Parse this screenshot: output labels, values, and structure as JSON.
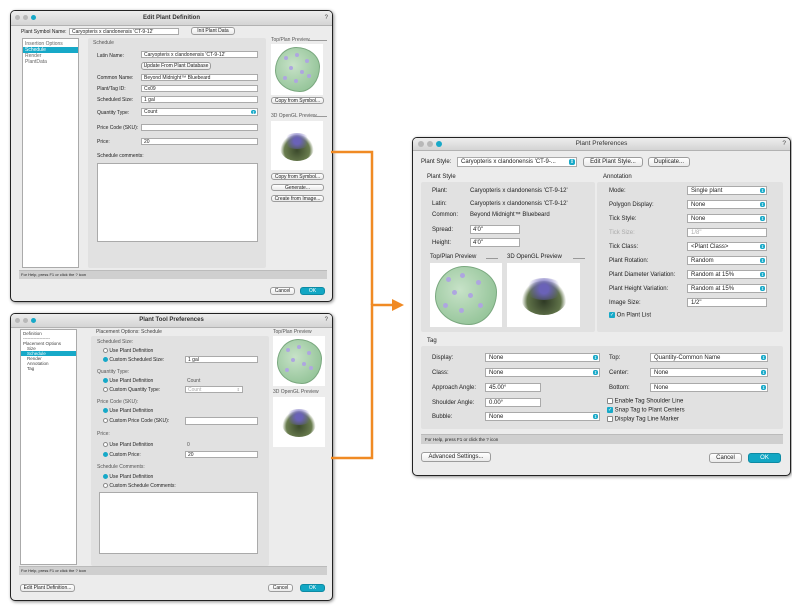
{
  "colors": {
    "accent": "#17a9c8",
    "arrow": "#f08a24",
    "close": "#e0443c",
    "min": "#e8b23a",
    "max": "#5cc04a"
  },
  "edit_plant": {
    "title": "Edit Plant Definition",
    "help": "?",
    "symbol_label": "Plant Symbol Name:",
    "symbol_value": "Caryopteris x clandonensis 'CT-9-12'",
    "init_button": "Init Plant Data",
    "sidebar": [
      "Insertion Options",
      "Schedule",
      "Render",
      "PlantData"
    ],
    "section": "Schedule",
    "latin_label": "Latin Name:",
    "latin_value": "Caryopteris x clandonensis 'CT-9-12'",
    "update_button": "Update From Plant Database",
    "common_label": "Common Name:",
    "common_value": "Beyond Midnight™ Bluebeard",
    "tag_label": "Plant/Tag ID:",
    "tag_value": "Cx09",
    "sched_size_label": "Scheduled Size:",
    "sched_size_value": "1 gal",
    "qty_label": "Quantity Type:",
    "qty_value": "Count",
    "price_code_label": "Price Code (SKU):",
    "price_code_value": "",
    "price_label": "Price:",
    "price_value": "20",
    "comments_label": "Schedule comments:",
    "top_preview": "Top/Plan Preview",
    "copy_symbol": "Copy from Symbol...",
    "opengl_preview": "3D OpenGL Preview",
    "copy_symbol2": "Copy from Symbol...",
    "generate": "Generate...",
    "create_image": "Create from Image...",
    "status": "For Help, press F1 or click the ? icon",
    "cancel": "Cancel",
    "ok": "OK"
  },
  "tool_prefs": {
    "title": "Plant Tool Preferences",
    "help": "?",
    "sidebar": [
      "Definition",
      "------------------",
      "Placement Options",
      "Size",
      "Schedule",
      "Render",
      "Annotation",
      "Tag"
    ],
    "section": "Placement Options: Schedule",
    "sched_size": "Scheduled Size:",
    "use_def": "Use Plant Definition",
    "custom_size": "Custom Scheduled Size:",
    "custom_size_value": "1 gal",
    "qty_type": "Quantity Type:",
    "use_def2": "Use Plant Definition",
    "count": "Count",
    "custom_qty": "Custom Quantity Type:",
    "custom_qty_value": "Count",
    "price_code": "Price Code (SKU):",
    "use_def3": "Use Plant Definition",
    "custom_price_code": "Custom Price Code (SKU):",
    "price": "Price:",
    "use_def4": "Use Plant Definition",
    "zero": "0",
    "custom_price": "Custom Price:",
    "custom_price_value": "20",
    "sched_comments": "Schedule Comments:",
    "use_def5": "Use Plant Definition",
    "custom_comments": "Custom Schedule Comments:",
    "top_preview": "Top/Plan Preview",
    "opengl_preview": "3D OpenGL Preview",
    "status": "For Help, press F1 or click the ? icon",
    "edit_button": "Edit Plant Definition...",
    "cancel": "Cancel",
    "ok": "OK"
  },
  "plant_prefs": {
    "title": "Plant Preferences",
    "help": "?",
    "style_label": "Plant Style:",
    "style_value": "Caryopteris x clandonensis 'CT-9-...",
    "edit_style": "Edit Plant Style...",
    "duplicate": "Duplicate...",
    "plant_style": "Plant Style",
    "plant_label": "Plant:",
    "plant_value": "Caryopteris x clandonensis 'CT-9-12'",
    "latin_label": "Latin:",
    "latin_value": "Caryopteris x clandonensis 'CT-9-12'",
    "common_label": "Common:",
    "common_value": "Beyond Midnight™ Bluebeard",
    "spread_label": "Spread:",
    "spread_value": "4'0\"",
    "height_label": "Height:",
    "height_value": "4'0\"",
    "top_preview": "Top/Plan Preview",
    "opengl_preview": "3D OpenGL Preview",
    "annotation": "Annotation",
    "mode_label": "Mode:",
    "mode_value": "Single plant",
    "polygon_label": "Polygon Display:",
    "polygon_value": "None",
    "tick_style_label": "Tick Style:",
    "tick_style_value": "None",
    "tick_size_label": "Tick Size:",
    "tick_size_value": "1/8\"",
    "tick_class_label": "Tick Class:",
    "tick_class_value": "<Plant Class>",
    "rotation_label": "Plant Rotation:",
    "rotation_value": "Random",
    "diam_label": "Plant Diameter Variation:",
    "diam_value": "Random at 15%",
    "height_var_label": "Plant Height Variation:",
    "height_var_value": "Random at 15%",
    "image_size_label": "Image Size:",
    "image_size_value": "1/2\"",
    "on_plant_list": "On Plant List",
    "tag": "Tag",
    "display_label": "Display:",
    "display_value": "None",
    "class_label": "Class:",
    "class_value": "None",
    "approach_label": "Approach Angle:",
    "approach_value": "45.00°",
    "shoulder_label": "Shoulder Angle:",
    "shoulder_value": "0.00°",
    "bubble_label": "Bubble:",
    "bubble_value": "None",
    "top_label": "Top:",
    "top_value": "Quantity-Common Name",
    "center_label": "Center:",
    "center_value": "None",
    "bottom_label": "Bottom:",
    "bottom_value": "None",
    "enable_shoulder": "Enable Tag Shoulder Line",
    "snap_tag": "Snap Tag to Plant Centers",
    "display_marker": "Display Tag Line Marker",
    "status": "For Help, press F1 or click the ? icon",
    "advanced": "Advanced Settings...",
    "cancel": "Cancel",
    "ok": "OK"
  }
}
